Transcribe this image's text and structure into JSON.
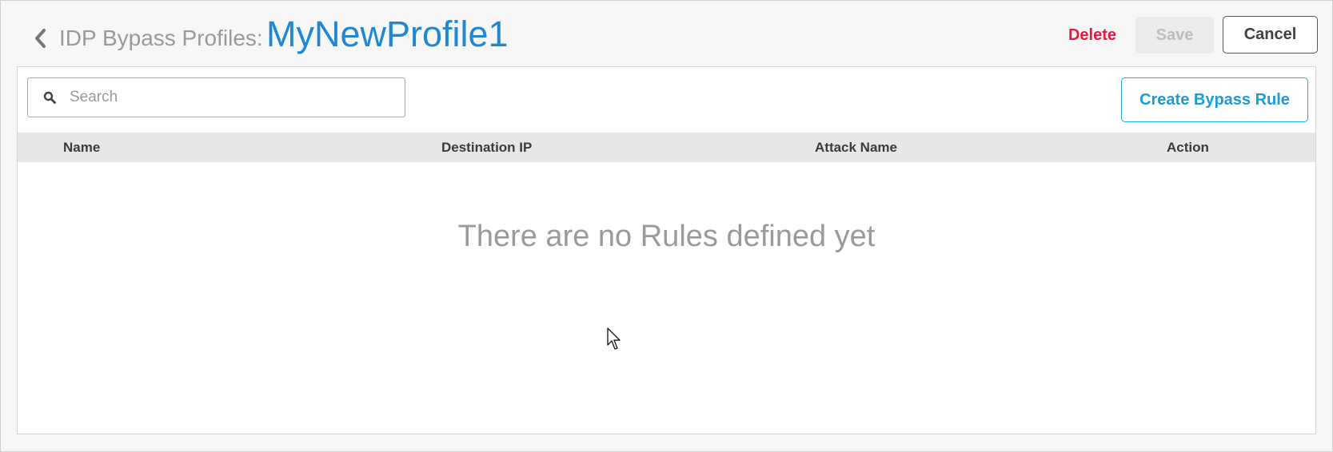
{
  "header": {
    "breadcrumb_parent": "IDP Bypass Profiles:",
    "profile_name": "MyNewProfile1",
    "delete_label": "Delete",
    "save_label": "Save",
    "cancel_label": "Cancel"
  },
  "toolbar": {
    "search_placeholder": "Search",
    "search_value": "",
    "create_label": "Create Bypass Rule"
  },
  "table": {
    "columns": [
      "Name",
      "Destination IP",
      "Attack Name",
      "Action"
    ],
    "rows": [],
    "empty_message": "There are no Rules defined yet"
  },
  "colors": {
    "accent": "#1e88d4",
    "danger": "#e31b3c"
  },
  "icons": {
    "back": "chevron-left-icon",
    "search": "search-icon",
    "cursor": "mouse-pointer-icon"
  }
}
